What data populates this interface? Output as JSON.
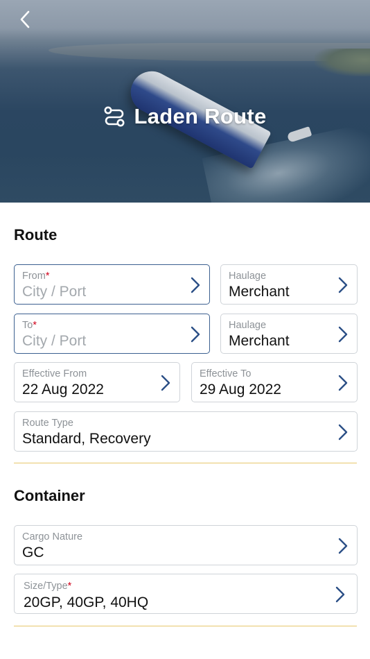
{
  "header": {
    "title": "Laden Route",
    "back_icon": "chevron-left-icon",
    "route_icon": "route-icon"
  },
  "route_section": {
    "title": "Route",
    "from": {
      "label": "From",
      "required_mark": "*",
      "placeholder": "City / Port"
    },
    "from_haulage": {
      "label": "Haulage",
      "value": "Merchant"
    },
    "to": {
      "label": "To",
      "required_mark": "*",
      "placeholder": "City / Port"
    },
    "to_haulage": {
      "label": "Haulage",
      "value": "Merchant"
    },
    "effective_from": {
      "label": "Effective From",
      "value": "22 Aug 2022"
    },
    "effective_to": {
      "label": "Effective To",
      "value": "29 Aug 2022"
    },
    "route_type": {
      "label": "Route Type",
      "value": "Standard, Recovery"
    }
  },
  "container_section": {
    "title": "Container",
    "cargo_nature": {
      "label": "Cargo Nature",
      "value": "GC"
    },
    "size_type": {
      "label": "Size/Type",
      "required_mark": "*",
      "value": "20GP, 40GP, 40HQ"
    }
  },
  "colors": {
    "chevron": "#2b4f86",
    "divider": "#e7c66a",
    "required": "#d0021b",
    "active_border": "#3b5f8f"
  }
}
